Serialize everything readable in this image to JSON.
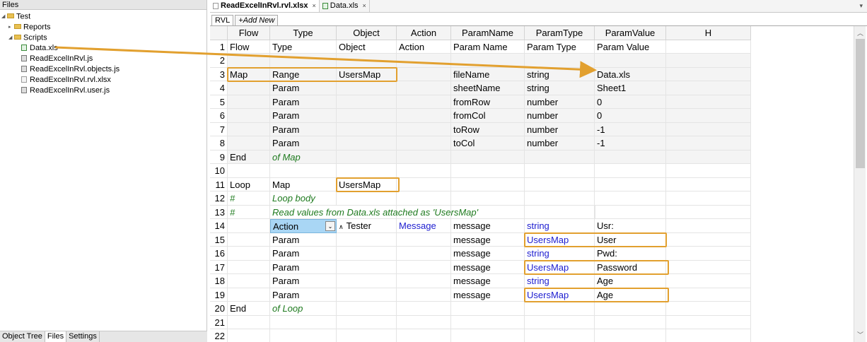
{
  "left_panel": {
    "title": "Files",
    "tree": [
      {
        "label": "Test",
        "kind": "folder",
        "expanded": true
      },
      {
        "label": "Reports",
        "kind": "folder",
        "expanded": false
      },
      {
        "label": "Scripts",
        "kind": "folder",
        "expanded": true
      },
      {
        "label": "Data.xls",
        "kind": "xls"
      },
      {
        "label": "ReadExcelInRvl.js",
        "kind": "js"
      },
      {
        "label": "ReadExcelInRvl.objects.js",
        "kind": "js"
      },
      {
        "label": "ReadExcelInRvl.rvl.xlsx",
        "kind": "xlsx"
      },
      {
        "label": "ReadExcelInRvl.user.js",
        "kind": "js"
      }
    ],
    "bottom_tabs": [
      "Object Tree",
      "Files",
      "Settings"
    ],
    "active_bottom_tab": "Files"
  },
  "editor": {
    "doc_tabs": [
      {
        "label": "ReadExcelInRvl.rvl.xlsx",
        "close": "×",
        "active": true
      },
      {
        "label": "Data.xls",
        "close": "×",
        "active": false
      }
    ],
    "sheet_tabs": [
      "RVL",
      "+Add New"
    ],
    "columns": [
      "",
      "Flow",
      "Type",
      "Object",
      "Action",
      "ParamName",
      "ParamType",
      "ParamValue",
      "H"
    ],
    "rows": [
      {
        "n": "1",
        "flow": "Flow",
        "type": "Type",
        "object": "Object",
        "action": "Action",
        "pname": "Param Name",
        "ptype": "Param Type",
        "pvalue": "Param Value",
        "shaded": false
      },
      {
        "n": "2",
        "flow": "",
        "type": "",
        "object": "",
        "action": "",
        "pname": "",
        "ptype": "",
        "pvalue": "",
        "shaded": true
      },
      {
        "n": "3",
        "flow": "Map",
        "type": "Range",
        "object": "UsersMap",
        "action": "",
        "pname": "fileName",
        "ptype": "string",
        "pvalue": "Data.xls",
        "shaded": true
      },
      {
        "n": "4",
        "flow": "",
        "type": "Param",
        "object": "",
        "action": "",
        "pname": "sheetName",
        "ptype": "string",
        "pvalue": "Sheet1",
        "shaded": true
      },
      {
        "n": "5",
        "flow": "",
        "type": "Param",
        "object": "",
        "action": "",
        "pname": "fromRow",
        "ptype": "number",
        "pvalue": "0",
        "shaded": true
      },
      {
        "n": "6",
        "flow": "",
        "type": "Param",
        "object": "",
        "action": "",
        "pname": "fromCol",
        "ptype": "number",
        "pvalue": "0",
        "shaded": true
      },
      {
        "n": "7",
        "flow": "",
        "type": "Param",
        "object": "",
        "action": "",
        "pname": "toRow",
        "ptype": "number",
        "pvalue": "-1",
        "shaded": true
      },
      {
        "n": "8",
        "flow": "",
        "type": "Param",
        "object": "",
        "action": "",
        "pname": "toCol",
        "ptype": "number",
        "pvalue": "-1",
        "shaded": true
      },
      {
        "n": "9",
        "flow": "End",
        "type": "of Map",
        "object": "",
        "action": "",
        "pname": "",
        "ptype": "",
        "pvalue": "",
        "shaded": true
      },
      {
        "n": "10",
        "flow": "",
        "type": "",
        "object": "",
        "action": "",
        "pname": "",
        "ptype": "",
        "pvalue": "",
        "shaded": false
      },
      {
        "n": "11",
        "flow": "Loop",
        "type": "Map",
        "object": "UsersMap",
        "action": "",
        "pname": "",
        "ptype": "",
        "pvalue": "",
        "shaded": false
      },
      {
        "n": "12",
        "flow": "#",
        "type": "Loop body",
        "object": "",
        "action": "",
        "pname": "",
        "ptype": "",
        "pvalue": "",
        "shaded": false
      },
      {
        "n": "13",
        "flow": "#",
        "type": "Read values from Data.xls attached as 'UsersMap'",
        "object": "",
        "action": "",
        "pname": "",
        "ptype": "",
        "pvalue": "",
        "shaded": false
      },
      {
        "n": "14",
        "flow": "",
        "type": "Action",
        "object": "Tester",
        "action": "Message",
        "pname": "message",
        "ptype": "string",
        "pvalue": "Usr:",
        "shaded": false
      },
      {
        "n": "15",
        "flow": "",
        "type": "Param",
        "object": "",
        "action": "",
        "pname": "message",
        "ptype": "UsersMap",
        "pvalue": "User",
        "shaded": false
      },
      {
        "n": "16",
        "flow": "",
        "type": "Param",
        "object": "",
        "action": "",
        "pname": "message",
        "ptype": "string",
        "pvalue": "Pwd:",
        "shaded": false
      },
      {
        "n": "17",
        "flow": "",
        "type": "Param",
        "object": "",
        "action": "",
        "pname": "message",
        "ptype": "UsersMap",
        "pvalue": "Password",
        "shaded": false
      },
      {
        "n": "18",
        "flow": "",
        "type": "Param",
        "object": "",
        "action": "",
        "pname": "message",
        "ptype": "string",
        "pvalue": "Age",
        "shaded": false
      },
      {
        "n": "19",
        "flow": "",
        "type": "Param",
        "object": "",
        "action": "",
        "pname": "message",
        "ptype": "UsersMap",
        "pvalue": "Age",
        "shaded": false
      },
      {
        "n": "20",
        "flow": "End",
        "type": "of Loop",
        "object": "",
        "action": "",
        "pname": "",
        "ptype": "",
        "pvalue": "",
        "shaded": false
      },
      {
        "n": "21",
        "flow": "",
        "type": "",
        "object": "",
        "action": "",
        "pname": "",
        "ptype": "",
        "pvalue": "",
        "shaded": false
      },
      {
        "n": "22",
        "flow": "",
        "type": "",
        "object": "",
        "action": "",
        "pname": "",
        "ptype": "",
        "pvalue": "",
        "shaded": false
      }
    ],
    "dropdown_glyph": "⌄",
    "tester_glyph": "∧"
  },
  "colors": {
    "highlight": "#e2a02f",
    "comment": "#1e7a1e",
    "keyword_blue": "#1d1dd0",
    "selected_cell": "#a9d6f5"
  },
  "icons": {
    "scroll_up": "chevron-up-icon",
    "scroll_down": "chevron-down-icon",
    "annotation_arrow": "arrow-icon"
  }
}
